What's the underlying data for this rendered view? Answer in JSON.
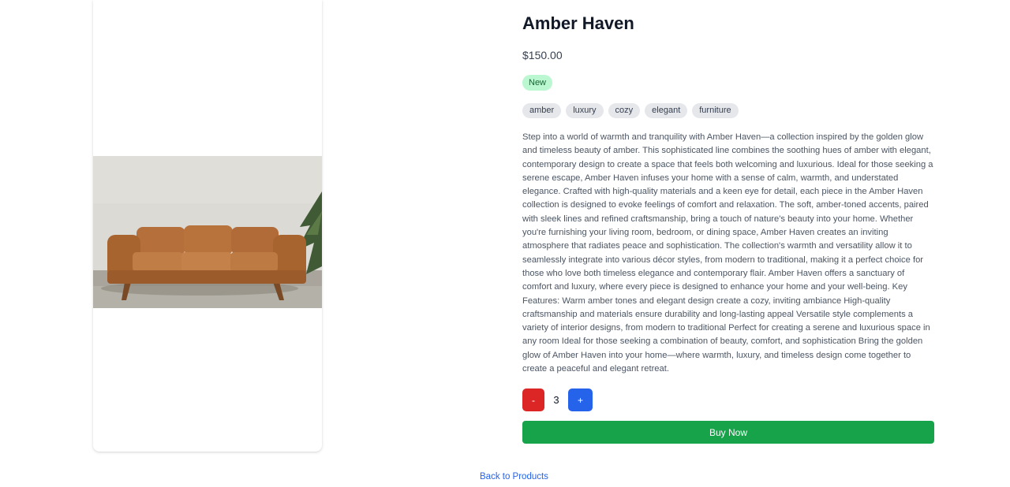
{
  "product": {
    "name": "Amber Haven",
    "price": "$150.00",
    "badge": "New",
    "tags": [
      "amber",
      "luxury",
      "cozy",
      "elegant",
      "furniture"
    ],
    "description": "Step into a world of warmth and tranquility with Amber Haven—a collection inspired by the golden glow and timeless beauty of amber. This sophisticated line combines the soothing hues of amber with elegant, contemporary design to create a space that feels both welcoming and luxurious. Ideal for those seeking a serene escape, Amber Haven infuses your home with a sense of calm, warmth, and understated elegance. Crafted with high-quality materials and a keen eye for detail, each piece in the Amber Haven collection is designed to evoke feelings of comfort and relaxation. The soft, amber-toned accents, paired with sleek lines and refined craftsmanship, bring a touch of nature's beauty into your home. Whether you're furnishing your living room, bedroom, or dining space, Amber Haven creates an inviting atmosphere that radiates peace and sophistication. The collection's warmth and versatility allow it to seamlessly integrate into various décor styles, from modern to traditional, making it a perfect choice for those who love both timeless elegance and contemporary flair. Amber Haven offers a sanctuary of comfort and luxury, where every piece is designed to enhance your home and your well-being. Key Features: Warm amber tones and elegant design create a cozy, inviting ambiance High-quality craftsmanship and materials ensure durability and long-lasting appeal Versatile style complements a variety of interior designs, from modern to traditional Perfect for creating a serene and luxurious space in any room Ideal for those seeking a combination of beauty, comfort, and sophistication Bring the golden glow of Amber Haven into your home—where warmth, luxury, and timeless design come together to create a peaceful and elegant retreat."
  },
  "quantity": {
    "minus_label": "-",
    "value": "3",
    "plus_label": "+"
  },
  "actions": {
    "buy_label": "Buy Now",
    "back_label": "Back to Products"
  },
  "colors": {
    "buy": "#16a34a",
    "minus": "#dc2626",
    "plus": "#2563eb",
    "badge_bg": "#bbf7d0",
    "link": "#2563eb"
  }
}
